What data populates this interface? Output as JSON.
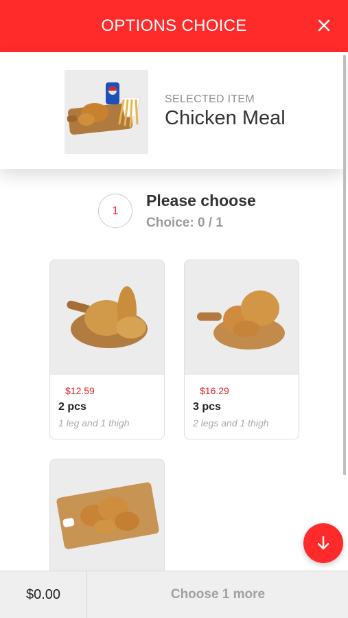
{
  "header": {
    "title": "OPTIONS CHOICE",
    "close_icon": "close-icon"
  },
  "selected": {
    "caption": "SELECTED ITEM",
    "name": "Chicken Meal"
  },
  "step": {
    "number": "1",
    "title": "Please choose",
    "count": "Choice: 0 / 1"
  },
  "options": [
    {
      "price": "$12.59",
      "name": "2 pcs",
      "desc": "1 leg and 1 thigh"
    },
    {
      "price": "$16.29",
      "name": "3 pcs",
      "desc": "2 legs and 1 thigh"
    },
    {
      "price": "",
      "name": "",
      "desc": ""
    }
  ],
  "footer": {
    "total": "$0.00",
    "action": "Choose 1 more"
  },
  "fab": {
    "icon": "arrow-down-icon"
  },
  "colors": {
    "accent": "#ff2a2a",
    "price": "#e02020",
    "muted": "#a0a0a0"
  }
}
